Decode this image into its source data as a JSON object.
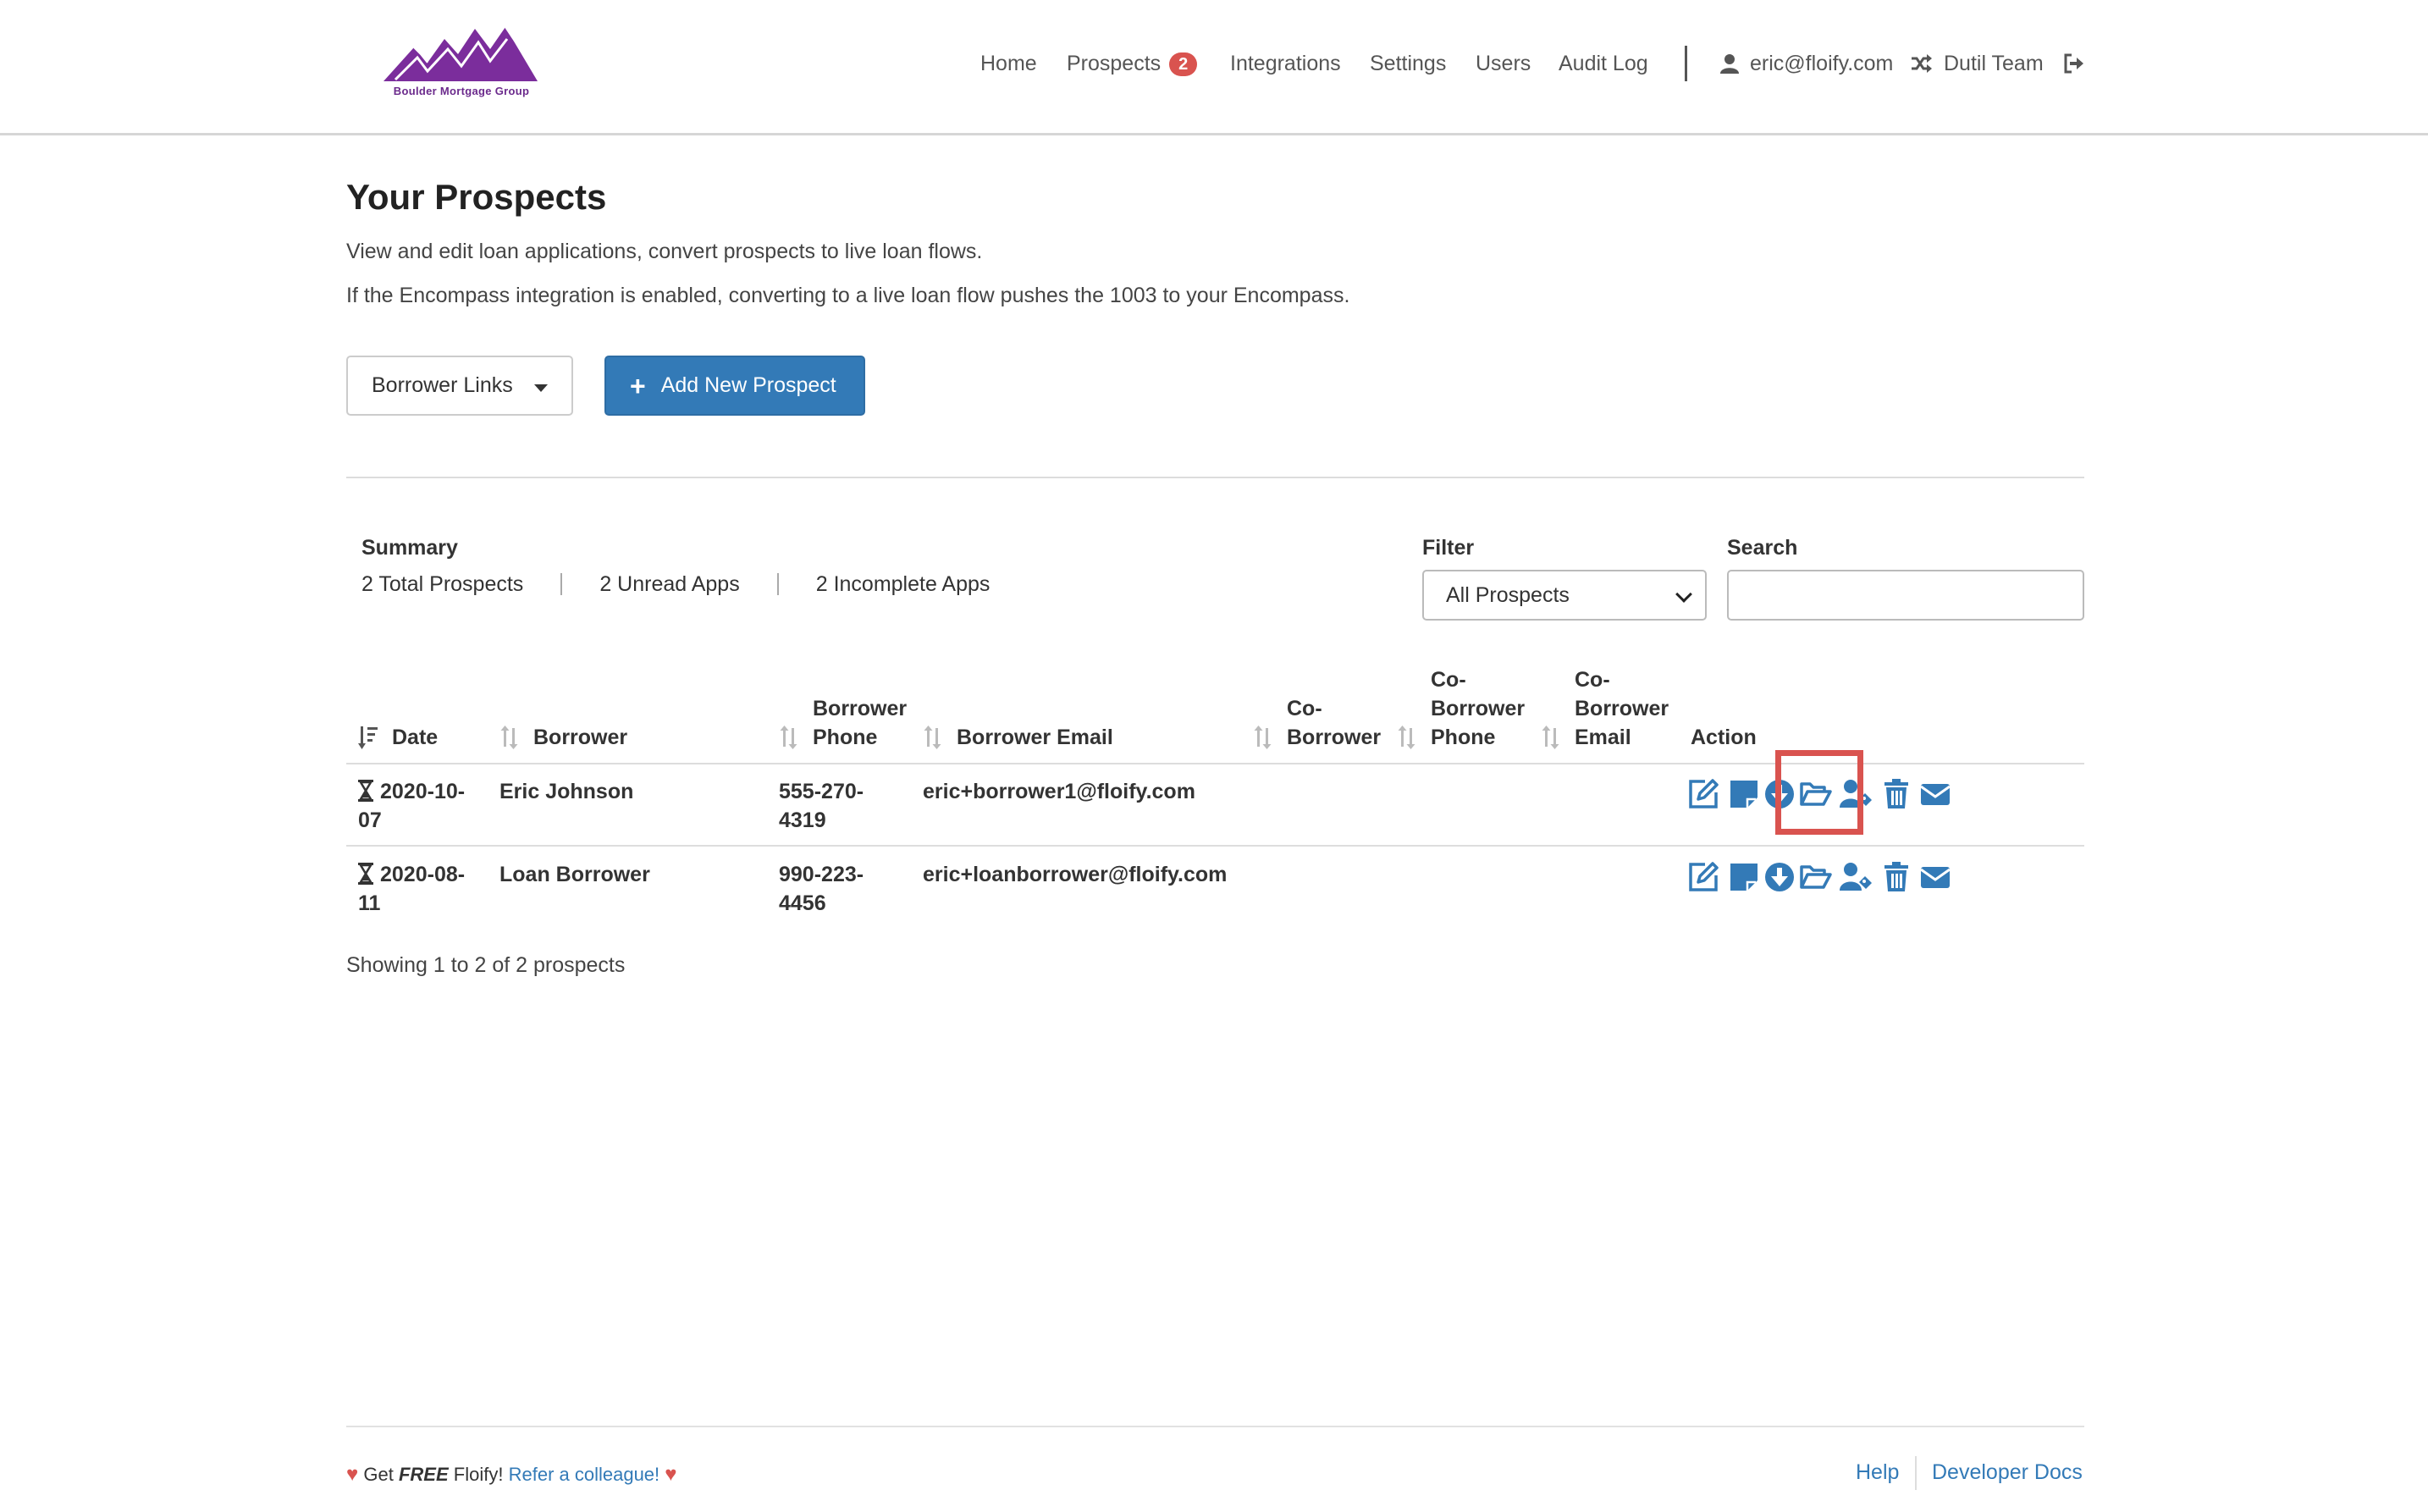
{
  "brand": {
    "logo_text": "Boulder Mortgage Group",
    "color": "#7b2d9c"
  },
  "nav": {
    "home": "Home",
    "prospects": "Prospects",
    "prospects_badge": "2",
    "integrations": "Integrations",
    "settings": "Settings",
    "users": "Users",
    "audit_log": "Audit Log",
    "user_email": "eric@floify.com",
    "team": "Dutil Team"
  },
  "page": {
    "title": "Your Prospects",
    "desc1": "View and edit loan applications, convert prospects to live loan flows.",
    "desc2": "If the Encompass integration is enabled, converting to a live loan flow pushes the 1003 to your Encompass.",
    "borrower_links": "Borrower Links",
    "add_new": "Add New Prospect"
  },
  "summary": {
    "label": "Summary",
    "total": "2 Total Prospects",
    "unread": "2 Unread Apps",
    "incomplete": "2 Incomplete Apps"
  },
  "filter": {
    "label": "Filter",
    "selected": "All Prospects"
  },
  "search": {
    "label": "Search",
    "value": ""
  },
  "table": {
    "headers": {
      "date": "Date",
      "borrower": "Borrower",
      "phone_l1": "Borrower",
      "phone_l2": "Phone",
      "email": "Borrower Email",
      "co_l1": "Co-",
      "co_l2": "Borrower",
      "cophone_l1": "Co-",
      "cophone_l2": "Borrower",
      "cophone_l3": "Phone",
      "coemail_l1": "Co-",
      "coemail_l2": "Borrower",
      "coemail_l3": "Email",
      "action": "Action"
    },
    "rows": [
      {
        "date_l1": "2020-10-",
        "date_l2": "07",
        "borrower": "Eric Johnson",
        "phone_l1": "555-270-",
        "phone_l2": "4319",
        "email": "eric+borrower1@floify.com"
      },
      {
        "date_l1": "2020-08-",
        "date_l2": "11",
        "borrower": "Loan Borrower",
        "phone_l1": "990-223-",
        "phone_l2": "4456",
        "email": "eric+loanborrower@floify.com"
      }
    ]
  },
  "showing": "Showing 1 to 2 of 2 prospects",
  "footer": {
    "get": "Get",
    "free": "FREE",
    "floify": "Floify!",
    "refer": "Refer a colleague!",
    "help": "Help",
    "dev_docs": "Developer Docs"
  },
  "colors": {
    "primary": "#337ab7",
    "badge": "#d9534f",
    "highlight": "#d9534f"
  }
}
